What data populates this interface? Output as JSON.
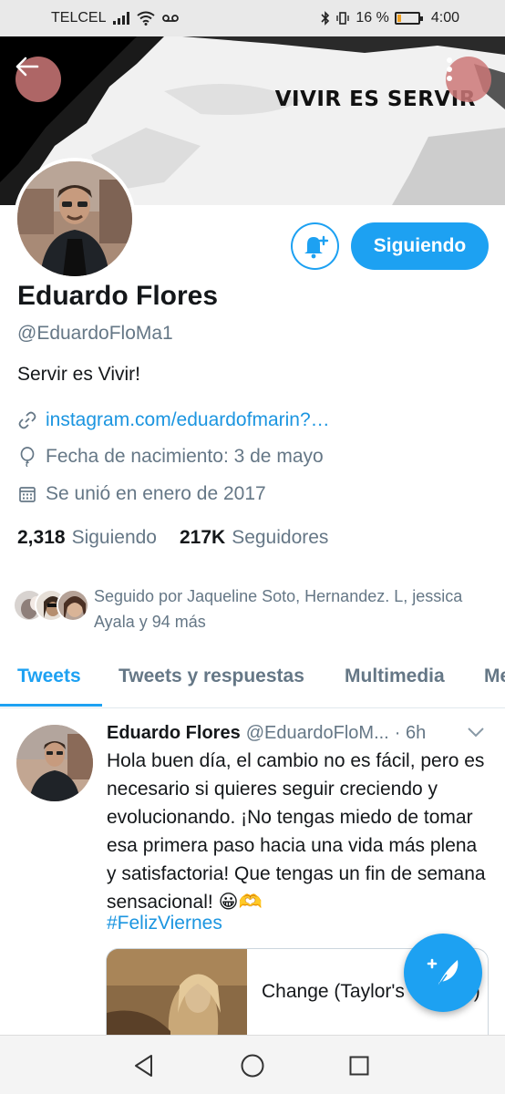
{
  "status_bar": {
    "carrier": "TELCEL",
    "battery_percent": "16 %",
    "time": "4:00",
    "battery_level": 0.16
  },
  "banner": {
    "text": "VIVIR ES SERVIR"
  },
  "profile": {
    "follow_button_label": "Siguiendo",
    "name": "Eduardo Flores",
    "handle": "@EduardoFloMa1",
    "bio": "Servir es Vivir!",
    "link": "instagram.com/eduardofmarin?…",
    "birthday": "Fecha de nacimiento: 3 de mayo",
    "joined": "Se unió en enero de 2017",
    "following_count": "2,318",
    "following_label": "Siguiendo",
    "followers_count": "217K",
    "followers_label": "Seguidores",
    "followed_by": "Seguido por Jaqueline Soto, Hernandez. L, jessica Ayala y 94 más"
  },
  "tabs": [
    {
      "label": "Tweets",
      "active": true
    },
    {
      "label": "Tweets y respuestas",
      "active": false
    },
    {
      "label": "Multimedia",
      "active": false
    },
    {
      "label": "Me",
      "active": false
    }
  ],
  "tweet": {
    "name": "Eduardo Flores",
    "handle": "@EduardoFloM...",
    "time": "· 6h",
    "text": "Hola buen día, el cambio no es fácil, pero es necesario si quieres seguir creciendo y evolucionando. ¡No tengas miedo de tomar esa primera paso hacia una vida más plena y satisfactoria! Que tengas un fin de semana sensacional! 😀🫶",
    "hashtag": "#FelizViernes",
    "card_title": "Change (Taylor's Version)"
  },
  "colors": {
    "accent": "#1da1f2",
    "link": "#1b95e0",
    "secondary_text": "#657786",
    "overlay_button": "#cd7878"
  },
  "icons": [
    "back-arrow-icon",
    "more-vertical-icon",
    "bell-plus-icon",
    "link-icon",
    "balloon-icon",
    "calendar-icon",
    "chevron-down-icon",
    "compose-tweet-icon",
    "nav-back-icon",
    "nav-home-icon",
    "nav-recents-icon"
  ]
}
